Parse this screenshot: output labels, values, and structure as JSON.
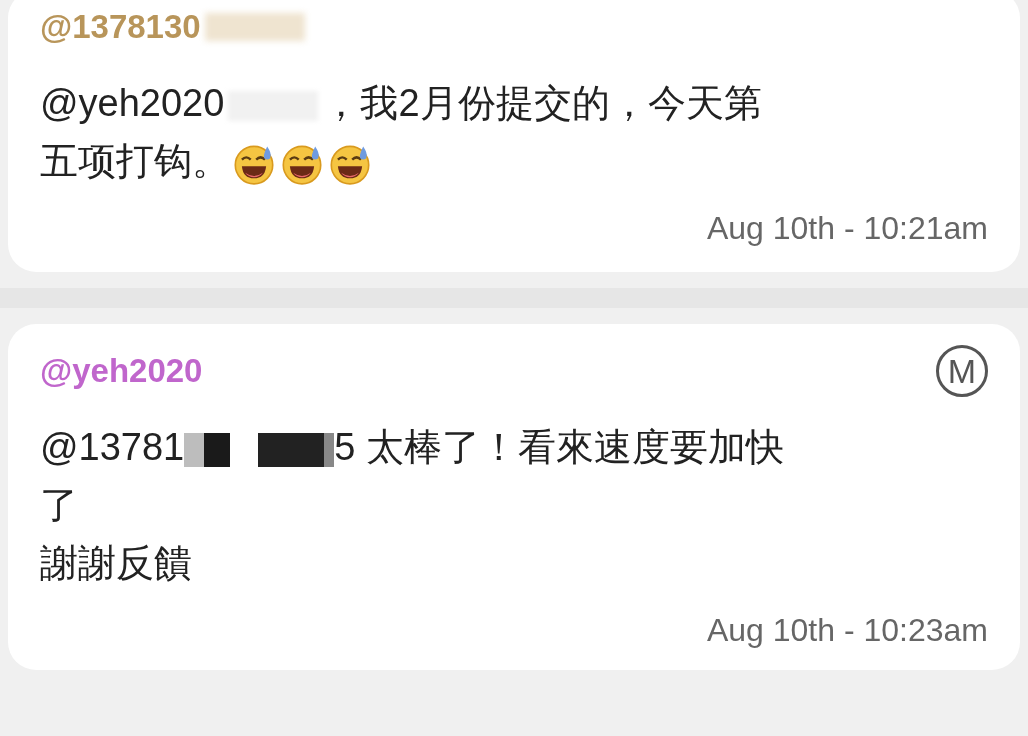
{
  "comments": [
    {
      "author": "@1378130",
      "color": "#b8955a",
      "author_redacted": true,
      "lines": [
        [
          {
            "kind": "text",
            "text": "@yeh2020"
          },
          {
            "kind": "blur"
          },
          {
            "kind": "text",
            "text": "，我2月份提交的，今天第"
          }
        ],
        [
          {
            "kind": "text",
            "text": "五项打钩。"
          },
          {
            "kind": "emoji"
          },
          {
            "kind": "emoji"
          },
          {
            "kind": "emoji"
          }
        ]
      ],
      "time": "Aug 10th - 10:21am"
    },
    {
      "author": "@yeh2020",
      "color": "#c066cc",
      "author_redacted": false,
      "badge": "M",
      "lines": [
        [
          {
            "kind": "text",
            "text": "@13781"
          },
          {
            "kind": "pixel"
          },
          {
            "kind": "text",
            "text": "5 太棒了！看來速度要加快"
          }
        ],
        [
          {
            "kind": "text",
            "text": "了"
          }
        ],
        [
          {
            "kind": "text",
            "text": "謝謝反饋"
          }
        ]
      ],
      "time": "Aug 10th - 10:23am"
    }
  ]
}
